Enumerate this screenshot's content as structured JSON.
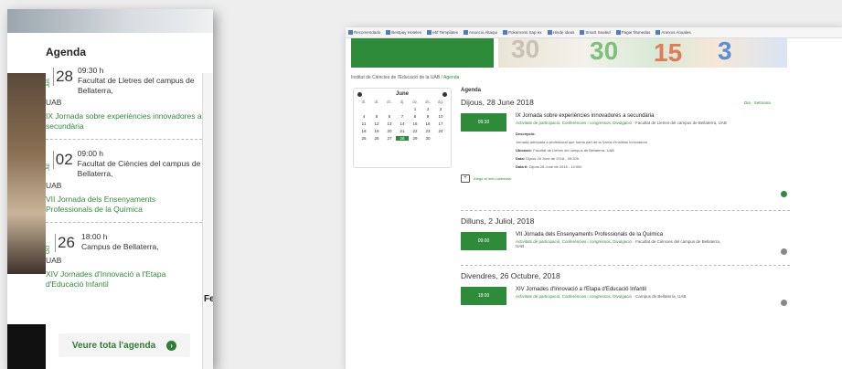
{
  "left": {
    "heading": "Agenda",
    "events": [
      {
        "month": "Jun",
        "day": "28",
        "time": "09:30 h",
        "place": "Facultat de Lletres del campus de Bellaterra,",
        "uab": "UAB",
        "title": "IX Jornada sobre experiències innovadores a secundària"
      },
      {
        "month": "Jul",
        "day": "02",
        "time": "09:00 h",
        "place": "Facultat de Ciències del campus de Bellaterra,",
        "uab": "UAB",
        "title": "VII Jornada dels Ensenyaments Professionals de la Química"
      },
      {
        "month": "Oct",
        "day": "26",
        "time": "18:00 h",
        "place": "Campus de Bellaterra,",
        "uab": "UAB",
        "title": "XIV Jornades d'Innovació a l'Etapa d'Educació Infantil"
      }
    ],
    "button_label": "Veure tota l'agenda",
    "side_label": "Fe"
  },
  "right": {
    "bookmarks": [
      "Recomendado",
      "Bestpay Hoteles",
      "ebf Templates",
      "Anuncio Altaqui",
      "Pokemons Sap ex",
      "Hinde ideas",
      "Smart Sealed",
      "Pagar Monedas",
      "Anexos Anuales"
    ],
    "breadcrumb": {
      "home": "Institut de Ciències de l'Educació de la UAB",
      "sep": "/",
      "current": "Agenda"
    },
    "calendar": {
      "month": "June",
      "weekdays": [
        "dl.",
        "dt.",
        "dc.",
        "dj.",
        "dv.",
        "ds.",
        "dg."
      ],
      "days": [
        "",
        "",
        "",
        "",
        "1",
        "2",
        "3",
        "4",
        "5",
        "6",
        "7",
        "8",
        "9",
        "10",
        "11",
        "12",
        "13",
        "14",
        "15",
        "16",
        "17",
        "18",
        "19",
        "20",
        "21",
        "22",
        "23",
        "24",
        "25",
        "26",
        "27",
        "28",
        "29",
        "30",
        ""
      ],
      "selected": "28"
    },
    "agenda_label": "Agenda",
    "view_toggle": "Dia · Setmana",
    "events": [
      {
        "date": "Dijous, 28 June 2018",
        "time": "09:30",
        "title": "IX Jornada sobre experiències innovadores a secundària",
        "categories": "Activitats de participació, Conferències i congressos, Divulgació",
        "place": "· Facultat de Lletres del campus de Bellaterra, UAB",
        "desc_label": "Descripció:",
        "desc_text": "Jornada adreçada a professorat que forma part de la Xarxa d'Instituts Innovadors",
        "loc_label": "Ubicació:",
        "loc_text": "Facultat de Lletres del campus de Bellaterra, UAB",
        "start_label": "Data:",
        "start_text": "Dijous 28 June de 2018 - 09:30h",
        "end_label": "Data fi:",
        "end_text": "Dijous 28 June de 2018 - 14:00h",
        "add_cal": "Afegir al meu calendari"
      },
      {
        "date": "Dilluns, 2 Juliol, 2018",
        "time": "09:00",
        "title": "VII Jornada dels Ensenyaments Professionals de la Química",
        "categories": "Activitats de participació, Conferències i congressos, Divulgació",
        "place": "· Facultat de Ciències del campus de Bellaterra,",
        "uab": "UAB"
      },
      {
        "date": "Divendres, 26 Octubre, 2018",
        "time": "18:00",
        "title": "XIV Jornades d'Innovació a l'Etapa d'Educació Infantil",
        "categories": "Activitats de participació, Conferències i congressos, Divulgació",
        "place": "· Campus de Bellaterra, UAB"
      }
    ]
  },
  "colors": {
    "accent": "#2e8b3a"
  }
}
